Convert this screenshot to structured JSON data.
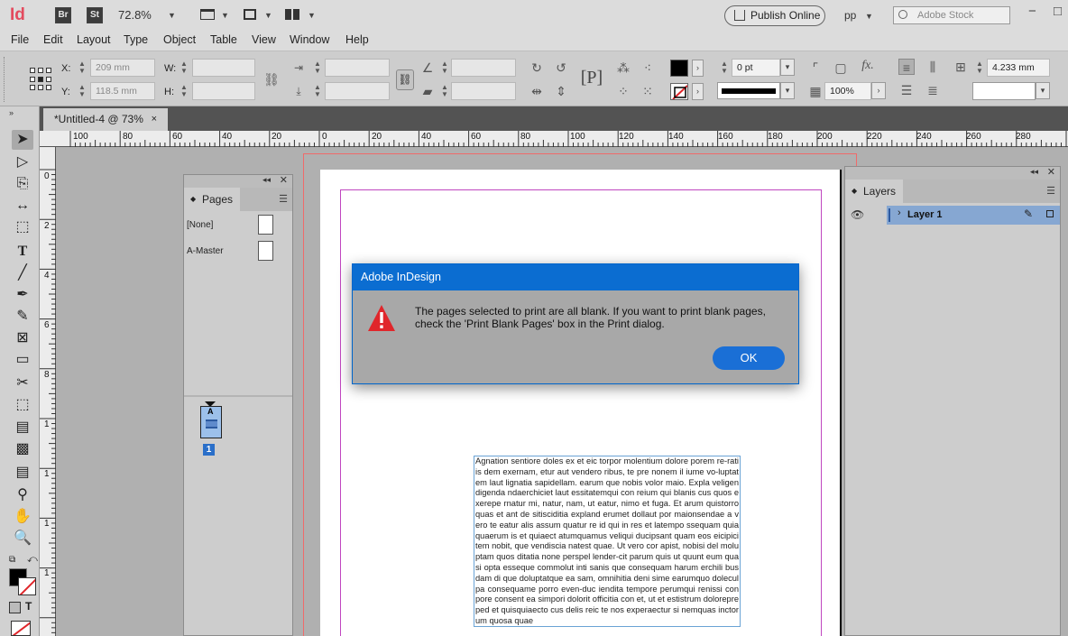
{
  "app": {
    "logo": "Id",
    "bridge": "Br",
    "stock_btn": "St",
    "zoom": "72.8%",
    "publish_label": "Publish Online",
    "workspace": "pp",
    "search_placeholder": "Adobe Stock"
  },
  "menu": [
    "File",
    "Edit",
    "Layout",
    "Type",
    "Object",
    "Table",
    "View",
    "Window",
    "Help"
  ],
  "control": {
    "x_label": "X:",
    "x_value": "209 mm",
    "y_label": "Y:",
    "y_value": "118.5 mm",
    "w_label": "W:",
    "h_label": "H:",
    "stroke_weight": "0 pt",
    "opacity": "100%",
    "gutter": "4.233 mm",
    "fx": "fx."
  },
  "document": {
    "tab_title": "*Untitled-4 @ 73%",
    "close": "×",
    "text_frame": "Agnation sentiore doles ex et eic torpor molentium dolore porem re-ratiis dem exernam, etur aut vendero ribus, te pre nonem il iume vo-luptatem laut lignatia sapidellam. earum que nobis volor maio. Expla veligen digenda ndaerchiciet laut essitatemqui con reium qui blanis cus quos exerepe rnatur mi, natur, nam, ut eatur, nimo et fuga. Et arum quistorro quas et ant de sitisciditia expland erumet dollaut por maionsendae a vero te eatur alis assum quatur re id qui in res et latempo ssequam quia quaerum is et quiaect atumquamus veliqui ducipsant quam eos eicipici tem nobit, que vendiscia natest quae. Ut vero cor apist, nobisi del moluptam quos ditatia none perspel lender-cit parum quis ut quunt eum quasi opta esseque commolut inti sanis que consequam harum erchili busdam di que doluptatque ea sam, omnihitia deni sime earumquo doleculpa consequame porro even-duc iendita tempore perumqui renissi con pore consent ea simpori dolorit officitia con et, ut et estistrum dolorepreped et quisquiaecto cus delis reic te nos experaectur si nemquas inctorum quosa quae"
  },
  "ruler": {
    "h_ticks": [
      "100",
      "80",
      "60",
      "40",
      "20",
      "0",
      "20",
      "40",
      "60",
      "80",
      "100",
      "120",
      "140",
      "160",
      "180",
      "200",
      "220",
      "240",
      "260",
      "280"
    ],
    "v_ticks": [
      "0",
      "2",
      "4",
      "6",
      "8",
      "1",
      "1",
      "1",
      "1"
    ]
  },
  "pages_panel": {
    "title": "Pages",
    "none_label": "[None]",
    "master_label": "A-Master",
    "page_master_letter": "A",
    "page_number": "1"
  },
  "layers_panel": {
    "title": "Layers",
    "layer_name": "Layer 1"
  },
  "dialog": {
    "title": "Adobe InDesign",
    "message": "The pages selected to print are all blank. If you want to print blank pages, check the 'Print Blank Pages' box in the Print dialog.",
    "ok_label": "OK"
  },
  "colors": {
    "dialog_title_bar": "#0b6dd1",
    "ok_button": "#1a6fd6",
    "warning": "#e0262b",
    "layer_highlight": "#86a7d2"
  }
}
